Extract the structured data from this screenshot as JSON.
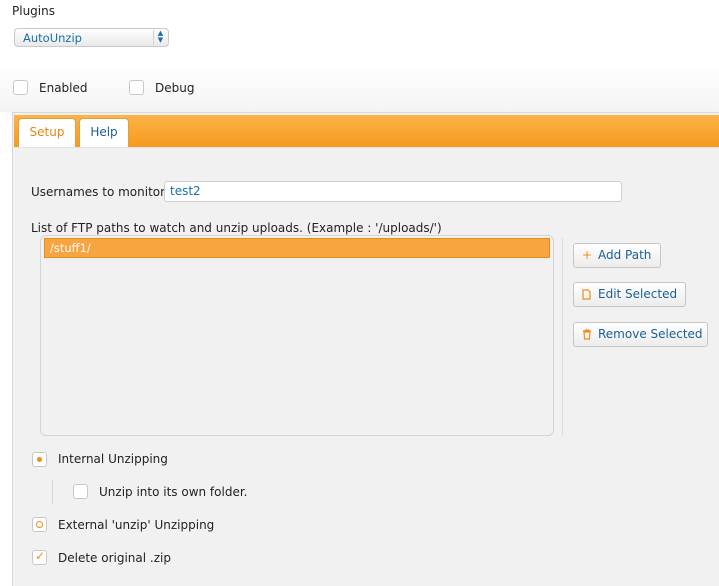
{
  "plugins": {
    "label": "Plugins",
    "selected": "AutoUnzip",
    "arrows_up": "▲",
    "arrows_down": "▼"
  },
  "options": {
    "enabled_label": "Enabled",
    "enabled_checked": false,
    "debug_label": "Debug",
    "debug_checked": false
  },
  "tabs": [
    {
      "label": "Setup",
      "active": true
    },
    {
      "label": "Help",
      "active": false
    }
  ],
  "setup": {
    "usernames_label": "Usernames to monitor :",
    "usernames_value": "test2",
    "paths_label": "List of FTP paths to watch and unzip uploads. (Example : '/uploads/')",
    "paths": [
      "/stuff1/"
    ],
    "buttons": {
      "add_path": "Add Path",
      "edit_selected": "Edit Selected",
      "remove_selected": "Remove Selected"
    },
    "icons": {
      "add": "plus-icon",
      "edit": "document-icon",
      "remove": "trash-icon"
    },
    "internal_unzip_label": "Internal Unzipping",
    "internal_unzip_selected": true,
    "own_folder_label": "Unzip into its own folder.",
    "own_folder_checked": false,
    "external_unzip_label": "External 'unzip' Unzipping",
    "external_unzip_selected": false,
    "delete_zip_label": "Delete original .zip",
    "delete_zip_checked": true
  },
  "colors": {
    "accent": "#f79a1d",
    "link": "#1a5f94"
  }
}
